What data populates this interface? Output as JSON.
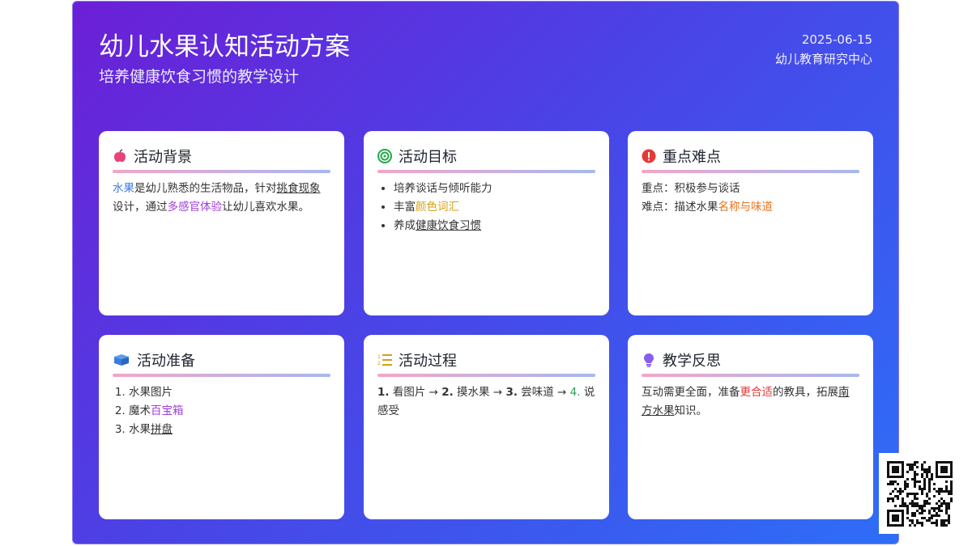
{
  "header": {
    "title": "幼儿水果认知活动方案",
    "subtitle": "培养健康饮食习惯的教学设计",
    "date": "2025-06-15",
    "org": "幼儿教育研究中心"
  },
  "cards": {
    "background": {
      "title": "活动背景",
      "icon": "apple-icon",
      "p1": "水果",
      "p2": "是幼儿熟悉的生活物品，针对",
      "p3": "挑食现象",
      "p4": "设计，通过",
      "p5": "多感官体验",
      "p6": "让幼儿喜欢水果。"
    },
    "goals": {
      "title": "活动目标",
      "icon": "target-icon",
      "items": [
        {
          "a": "培养谈话与倾听能力"
        },
        {
          "a": "丰富",
          "b": "颜色词汇"
        },
        {
          "a": "养成",
          "b": "健康饮食习惯"
        }
      ]
    },
    "keypoints": {
      "title": "重点难点",
      "icon": "exclamation-icon",
      "line1": "重点：积极参与谈话",
      "line2a": "难点：描述水果",
      "line2b": "名称与味道"
    },
    "prep": {
      "title": "活动准备",
      "icon": "box-icon",
      "items": [
        {
          "a": "水果图片"
        },
        {
          "a": "魔术",
          "b": "百宝箱"
        },
        {
          "a": "水果",
          "b": "拼盘"
        }
      ]
    },
    "process": {
      "title": "活动过程",
      "icon": "numbered-list-icon",
      "s1n": "1.",
      "s1": " 看图片 → ",
      "s2n": "2.",
      "s2": " 摸水果 → ",
      "s3n": "3.",
      "s3": " 尝味道 → ",
      "s4n": "4.",
      "s4": " 说感受"
    },
    "reflection": {
      "title": "教学反思",
      "icon": "lightbulb-icon",
      "p1": "互动需更全面，准备",
      "p2": "更合适",
      "p3": "的教具，拓展",
      "p4": "南方水果",
      "p5": "知识。"
    }
  },
  "colors": {
    "gradient_start": "#6c1fd6",
    "gradient_end": "#2d6ef7",
    "accent_blue": "#3b7be0",
    "accent_purple": "#a040d8",
    "accent_gold": "#d4a017",
    "accent_orange": "#e8731a",
    "accent_red": "#e53935",
    "accent_green": "#2e9d4f"
  }
}
